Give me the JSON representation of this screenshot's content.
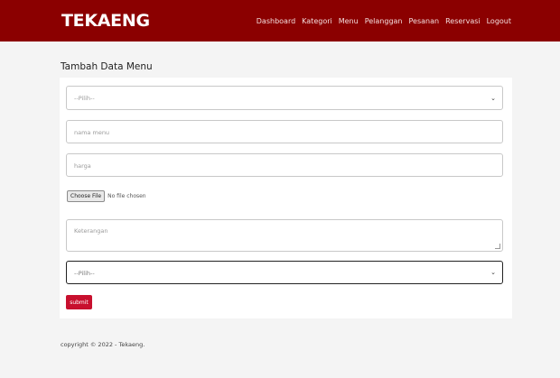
{
  "header": {
    "brand": "TEKAENG",
    "nav": [
      "Dashboard",
      "Kategori",
      "Menu",
      "Pelanggan",
      "Pesanan",
      "Reservasi",
      "Logout"
    ]
  },
  "page": {
    "title": "Tambah Data Menu"
  },
  "form": {
    "select_kategori": {
      "value": "--Pilih--"
    },
    "nama_menu": {
      "placeholder": "nama menu"
    },
    "harga": {
      "placeholder": "harga"
    },
    "file": {
      "button_label": "Choose File",
      "status": "No file chosen"
    },
    "keterangan": {
      "placeholder": "Keterangan"
    },
    "select_status": {
      "value": "--Pilih--"
    },
    "submit_label": "submit"
  },
  "footer": {
    "text": "copyright © 2022 - Tekaeng."
  },
  "colors": {
    "navbar": "#8b0000",
    "submit": "#c8102e",
    "background": "#f4f4f4"
  },
  "icons": {
    "select_chevron": "chevron-down-icon"
  }
}
